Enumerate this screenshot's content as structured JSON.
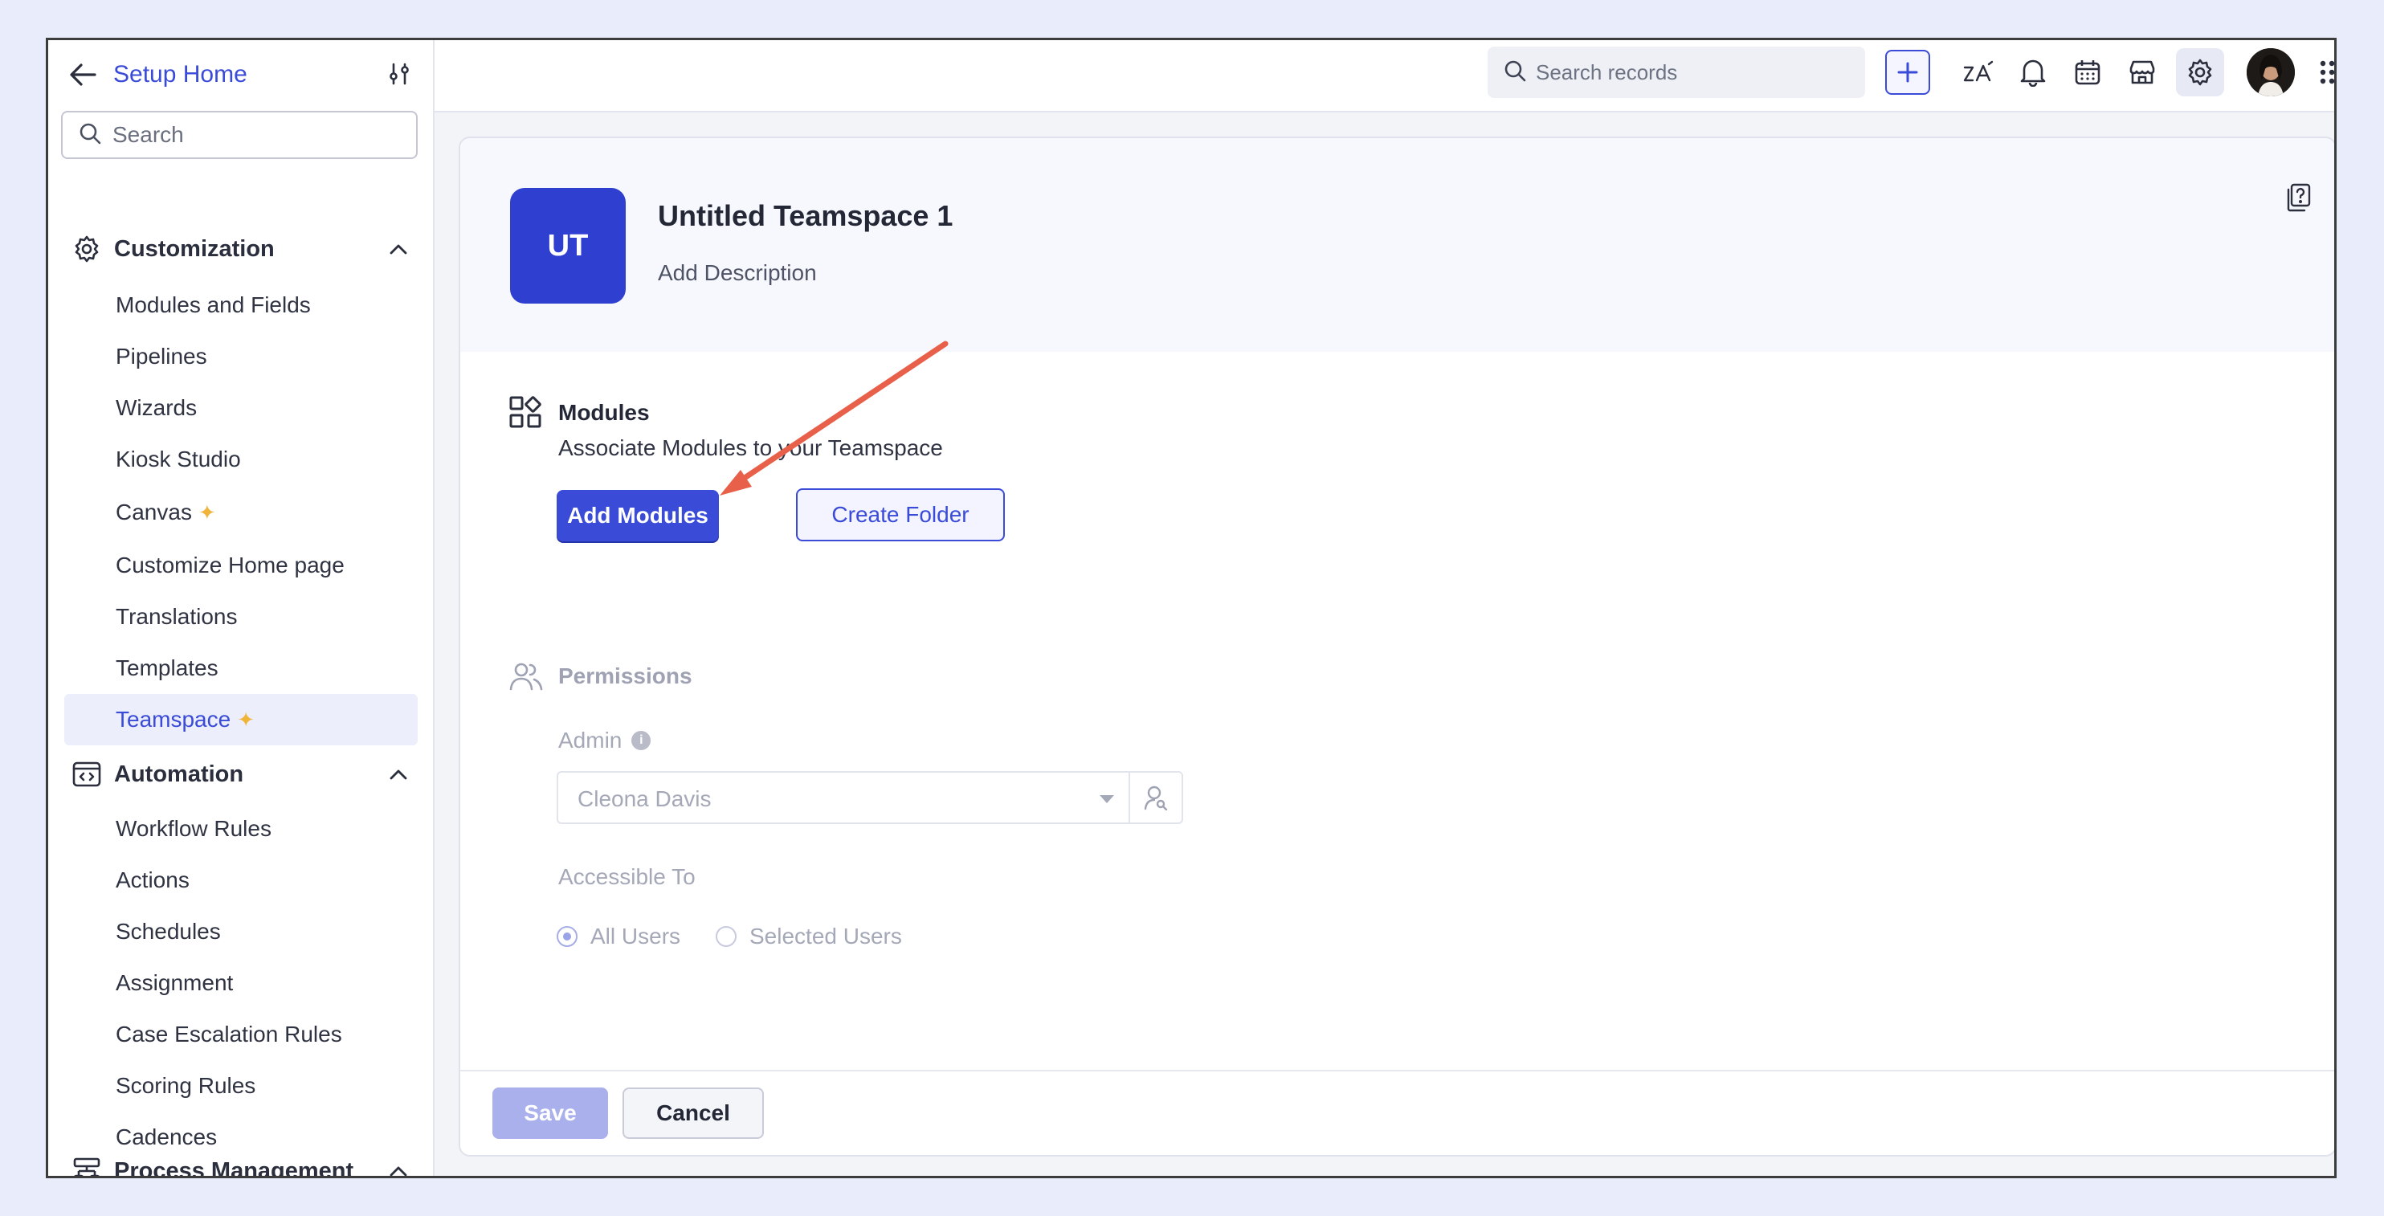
{
  "sidebar": {
    "title": "Setup Home",
    "search_placeholder": "Search",
    "sections": [
      {
        "label": "Customization",
        "items": [
          "Modules and Fields",
          "Pipelines",
          "Wizards",
          "Kiosk Studio",
          "Canvas",
          "Customize Home page",
          "Translations",
          "Templates",
          "Teamspace"
        ]
      },
      {
        "label": "Automation",
        "items": [
          "Workflow Rules",
          "Actions",
          "Schedules",
          "Assignment",
          "Case Escalation Rules",
          "Scoring Rules",
          "Cadences"
        ]
      },
      {
        "label": "Process Management"
      }
    ],
    "active_item": "Teamspace"
  },
  "topbar": {
    "search_placeholder": "Search records",
    "icons": [
      "plus-icon",
      "zia-icon",
      "bell-icon",
      "calendar-icon",
      "marketplace-icon",
      "gear-icon",
      "avatar",
      "apps-grid-icon"
    ]
  },
  "teamspace": {
    "initials": "UT",
    "name": "Untitled Teamspace 1",
    "description": "Add Description"
  },
  "modules": {
    "title": "Modules",
    "subtitle": "Associate Modules to your Teamspace",
    "add_label": "Add Modules",
    "folder_label": "Create Folder"
  },
  "permissions": {
    "title": "Permissions",
    "admin_label": "Admin",
    "admin_value": "Cleona Davis",
    "accessible_label": "Accessible To",
    "options": [
      "All Users",
      "Selected Users"
    ],
    "selected_option": "All Users"
  },
  "footer": {
    "save_label": "Save",
    "cancel_label": "Cancel"
  },
  "colors": {
    "accent": "#3a4bd8",
    "badge": "#2f3fcf",
    "annotation_arrow": "#e8604a",
    "sparkle": "#f0b43a"
  }
}
